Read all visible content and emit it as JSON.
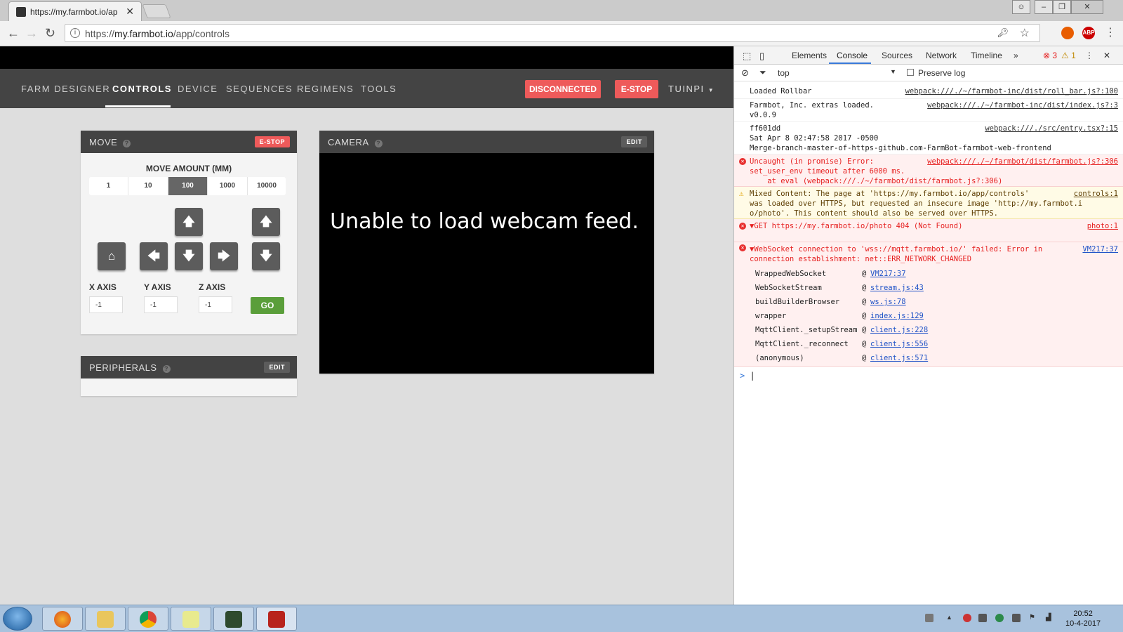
{
  "browser": {
    "tab_title": "https://my.farmbot.io/ap",
    "url_scheme": "https://",
    "url_host": "my.farmbot.io",
    "url_path": "/app/controls",
    "ext_abp": "ABP"
  },
  "nav": {
    "items": [
      "FARM DESIGNER",
      "CONTROLS",
      "DEVICE",
      "SEQUENCES",
      "REGIMENS",
      "TOOLS"
    ],
    "active": "CONTROLS",
    "status_button": "DISCONNECTED",
    "estop_button": "E-STOP",
    "bot_name": "TUINPI"
  },
  "move": {
    "title": "MOVE",
    "estop": "E-STOP",
    "amount_label": "MOVE AMOUNT (MM)",
    "amounts": [
      "1",
      "10",
      "100",
      "1000",
      "10000"
    ],
    "selected_amount": "100",
    "axes": [
      {
        "label": "X AXIS",
        "value": "-1"
      },
      {
        "label": "Y AXIS",
        "value": "-1"
      },
      {
        "label": "Z AXIS",
        "value": "-1"
      }
    ],
    "go_label": "GO"
  },
  "peripherals": {
    "title": "PERIPHERALS",
    "edit": "EDIT"
  },
  "camera": {
    "title": "CAMERA",
    "edit": "EDIT",
    "message": "Unable to load webcam feed."
  },
  "devtools": {
    "tabs": [
      "Elements",
      "Console",
      "Sources",
      "Network",
      "Timeline"
    ],
    "active_tab": "Console",
    "error_count": "3",
    "warning_count": "1",
    "context": "top",
    "preserve_log": "Preserve log",
    "logs": [
      {
        "level": "info",
        "lines": [
          "Loaded Rollbar"
        ],
        "source": "webpack:///./~/farmbot-inc/dist/roll_bar.js?:100"
      },
      {
        "level": "info",
        "lines": [
          "Farmbot, Inc. extras loaded.",
          "v0.0.9"
        ],
        "source": "webpack:///./~/farmbot-inc/dist/index.js?:3"
      },
      {
        "level": "info",
        "lines": [
          "ff601dd",
          "Sat Apr 8 02:47:58 2017 -0500",
          "Merge-branch-master-of-https-github.com-FarmBot-farmbot-web-frontend"
        ],
        "source": "webpack:///./src/entry.tsx?:15"
      },
      {
        "level": "error",
        "lines": [
          "Uncaught (in promise) Error:",
          "set_user_env timeout after 6000 ms.",
          "    at eval (webpack:///./~/farmbot/dist/farmbot.js?:306)"
        ],
        "source": "webpack:///./~/farmbot/dist/farmbot.js?:306"
      },
      {
        "level": "warning",
        "lines": [
          "Mixed Content: The page at 'https://my.farmbot.io/app/controls'",
          "was loaded over HTTPS, but requested an insecure image 'http://my.farmbot.i",
          "o/photo'. This content should also be served over HTTPS."
        ],
        "source": "controls:1"
      },
      {
        "level": "error",
        "lines": [
          "▼GET https://my.farmbot.io/photo 404 (Not Found)"
        ],
        "source": "photo:1"
      },
      {
        "level": "error",
        "lines": [
          "▼WebSocket connection to 'wss://mqtt.farmbot.io/' failed: Error in",
          "connection establishment: net::ERR_NETWORK_CHANGED"
        ],
        "source": "VM217:37"
      }
    ],
    "stack": [
      {
        "fn": "WrappedWebSocket",
        "link": "VM217:37"
      },
      {
        "fn": "WebSocketStream",
        "link": "stream.js:43"
      },
      {
        "fn": "buildBuilderBrowser",
        "link": "ws.js:78"
      },
      {
        "fn": "wrapper",
        "link": "index.js:129"
      },
      {
        "fn": "MqttClient._setupStream",
        "link": "client.js:228"
      },
      {
        "fn": "MqttClient._reconnect",
        "link": "client.js:556"
      },
      {
        "fn": "(anonymous)",
        "link": "client.js:571"
      }
    ],
    "prompt": ">"
  },
  "taskbar": {
    "time": "20:52",
    "date": "10-4-2017"
  }
}
